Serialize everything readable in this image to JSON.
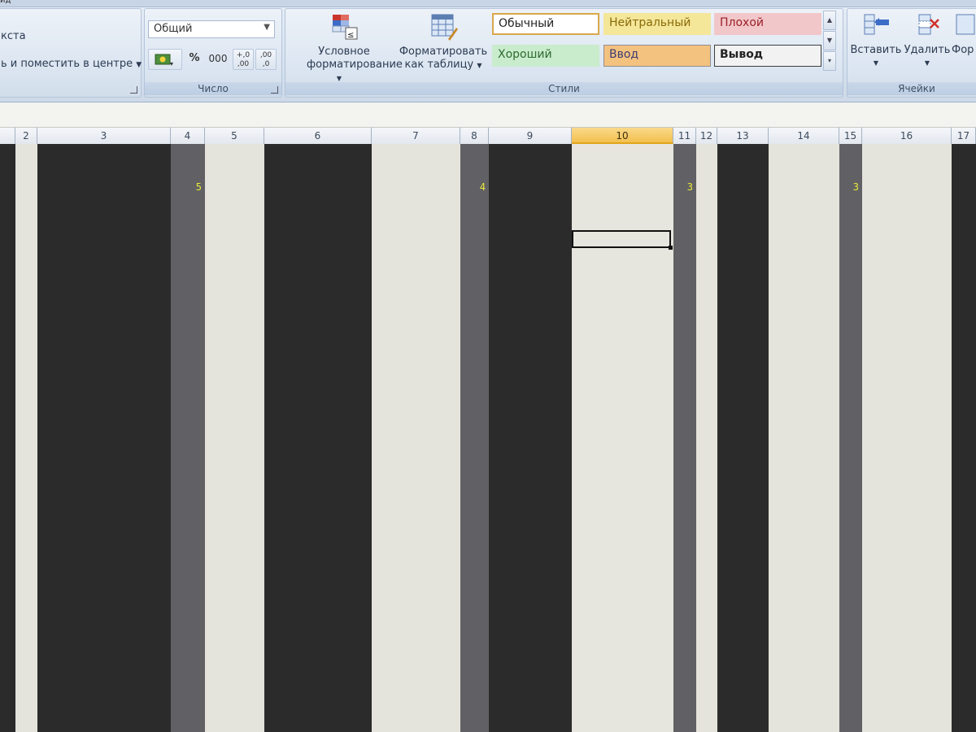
{
  "ribbon": {
    "top_tab_fragment": "ид",
    "alignment": {
      "wrap_text_fragment": "кста",
      "merge_center_label": "ь и поместить в центре"
    },
    "number": {
      "format_value": "Общий",
      "percent_label": "%",
      "thousands_label": "000",
      "increase_decimal_label": "+,0 ,00",
      "decrease_decimal_label": ",00 ,0",
      "group_label": "Число"
    },
    "styles": {
      "conditional_formatting_line1": "Условное",
      "conditional_formatting_line2": "форматирование",
      "format_as_table_line1": "Форматировать",
      "format_as_table_line2": "как таблицу",
      "cells": [
        {
          "label": "Обычный",
          "bg": "#ffffff",
          "border": "#d9a84a",
          "fg": "#222222"
        },
        {
          "label": "Нейтральный",
          "bg": "#f4e79a",
          "border": "#f4e79a",
          "fg": "#8a6a06"
        },
        {
          "label": "Плохой",
          "bg": "#f2c7c9",
          "border": "#f2c7c9",
          "fg": "#9a1f28"
        },
        {
          "label": "Хороший",
          "bg": "#c9eccd",
          "border": "#c9eccd",
          "fg": "#2f6b2f"
        },
        {
          "label": "Ввод",
          "bg": "#f4c27f",
          "border": "#8f8f8f",
          "fg": "#3d3d70"
        },
        {
          "label": "Вывод",
          "bg": "#f2f2f2",
          "border": "#3f3f3f",
          "fg": "#222222"
        }
      ],
      "group_label": "Стили"
    },
    "cells_group": {
      "insert_label": "Вставить",
      "delete_label": "Удалить",
      "format_label_fragment": "Фор",
      "group_label": "Ячейки"
    }
  },
  "columns": [
    {
      "label": "2",
      "fill": "#e4e3dc",
      "value": ""
    },
    {
      "label": "3",
      "fill": "#2b2b2b",
      "value": ""
    },
    {
      "label": "4",
      "fill": "#616165",
      "value": "5"
    },
    {
      "label": "5",
      "fill": "#e4e3dc",
      "value": ""
    },
    {
      "label": "6",
      "fill": "#2b2b2b",
      "value": ""
    },
    {
      "label": "7",
      "fill": "#e4e3dc",
      "value": ""
    },
    {
      "label": "8",
      "fill": "#616165",
      "value": "4"
    },
    {
      "label": "9",
      "fill": "#2b2b2b",
      "value": ""
    },
    {
      "label": "10",
      "fill": "#e6e5de",
      "value": "",
      "selected": true
    },
    {
      "label": "11",
      "fill": "#616165",
      "value": "3"
    },
    {
      "label": "12",
      "fill": "#e4e3dc",
      "value": ""
    },
    {
      "label": "13",
      "fill": "#2b2b2b",
      "value": ""
    },
    {
      "label": "14",
      "fill": "#e4e3dc",
      "value": ""
    },
    {
      "label": "15",
      "fill": "#616165",
      "value": "3"
    },
    {
      "label": "16",
      "fill": "#e4e3dc",
      "value": ""
    },
    {
      "label": "17",
      "fill": "#2b2b2b",
      "value": ""
    }
  ],
  "colors": {
    "accent_selected_header": "#f3c04f",
    "cell_value_text": "#e8e83a"
  }
}
